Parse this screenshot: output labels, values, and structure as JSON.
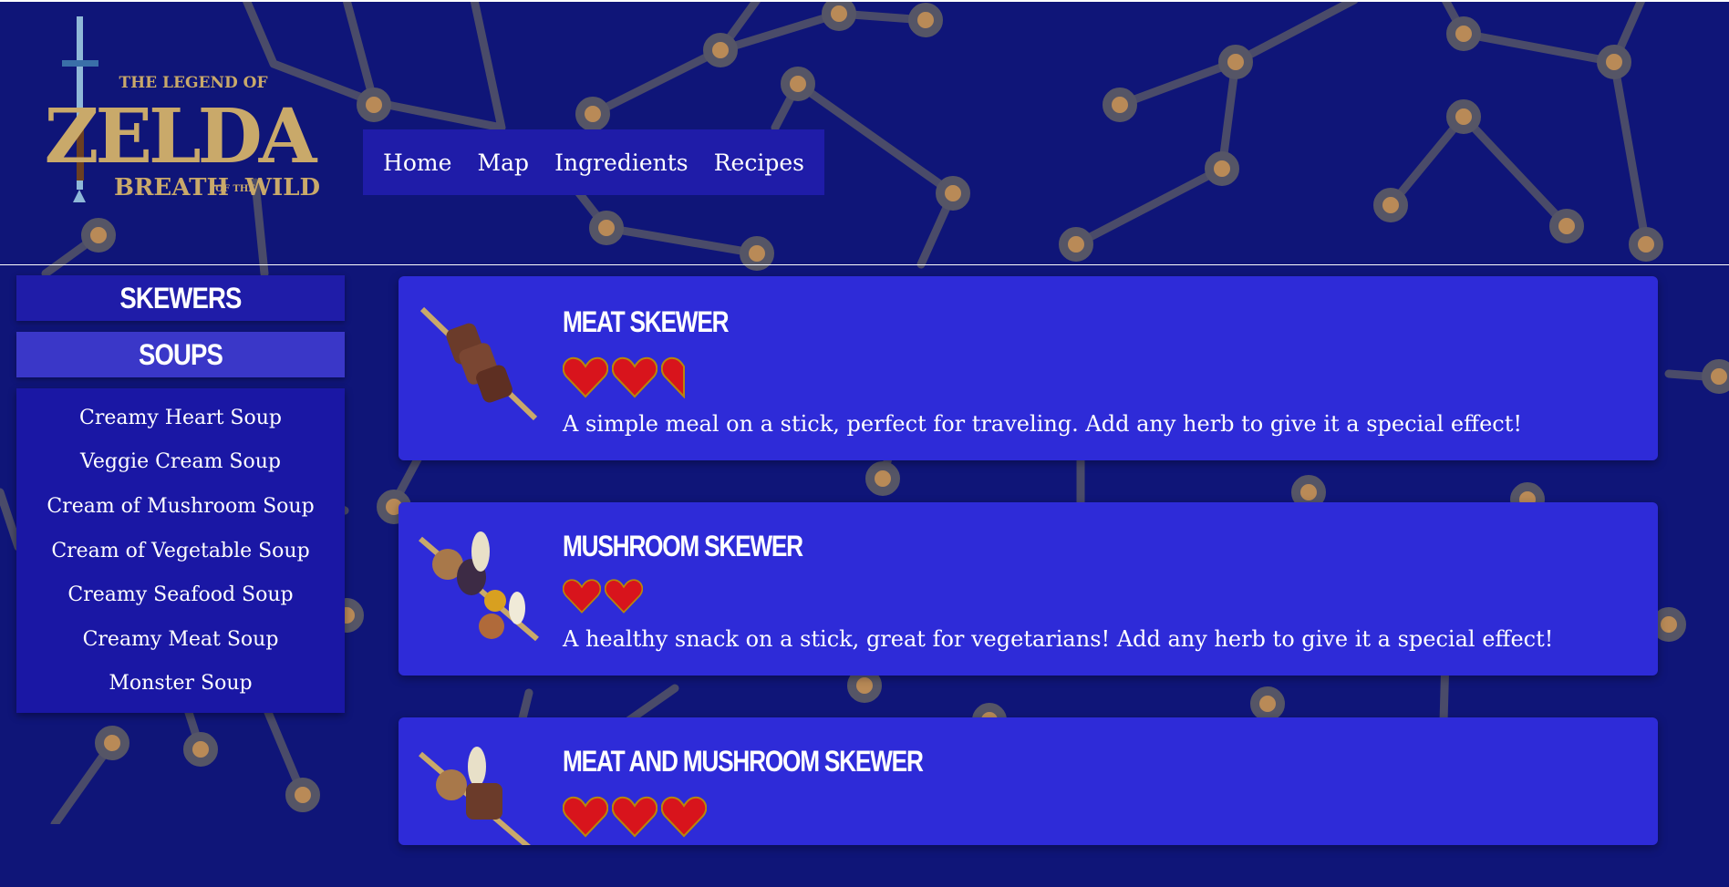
{
  "nav": {
    "items": [
      {
        "label": "Home"
      },
      {
        "label": "Map"
      },
      {
        "label": "Ingredients"
      },
      {
        "label": "Recipes"
      }
    ]
  },
  "logo": {
    "line1": "THE LEGEND OF",
    "line2": "ZELDA",
    "line3": "BREATH",
    "line3b": "OF THE",
    "line4": "WILD"
  },
  "sidebar": {
    "categories": [
      {
        "label": "SKEWERS"
      },
      {
        "label": "SOUPS"
      }
    ],
    "soups": [
      "Creamy Heart Soup",
      "Veggie Cream Soup",
      "Cream of Mushroom Soup",
      "Cream of Vegetable Soup",
      "Creamy Seafood Soup",
      "Creamy Meat Soup",
      "Monster Soup"
    ]
  },
  "recipes": [
    {
      "title": "MEAT SKEWER",
      "hearts": 2.5,
      "description": "A simple meal on a stick, perfect for traveling. Add any herb to give it a special effect!"
    },
    {
      "title": "MUSHROOM SKEWER",
      "hearts": 2,
      "description": "A healthy snack on a stick, great for vegetarians! Add any herb to give it a special effect!"
    },
    {
      "title": "MEAT AND MUSHROOM SKEWER",
      "hearts": 3,
      "description": ""
    }
  ],
  "colors": {
    "background": "#0f1578",
    "nav_bg": "#1f1ca8",
    "card_bg": "#2e2bd8",
    "active_category": "#3a37c8",
    "logo_gold": "#c9a96a",
    "heart_red": "#d8141c",
    "node": "#b98a57",
    "link_line": "#505060"
  },
  "icons": {
    "heart": "heart-icon",
    "sword": "master-sword-icon"
  }
}
